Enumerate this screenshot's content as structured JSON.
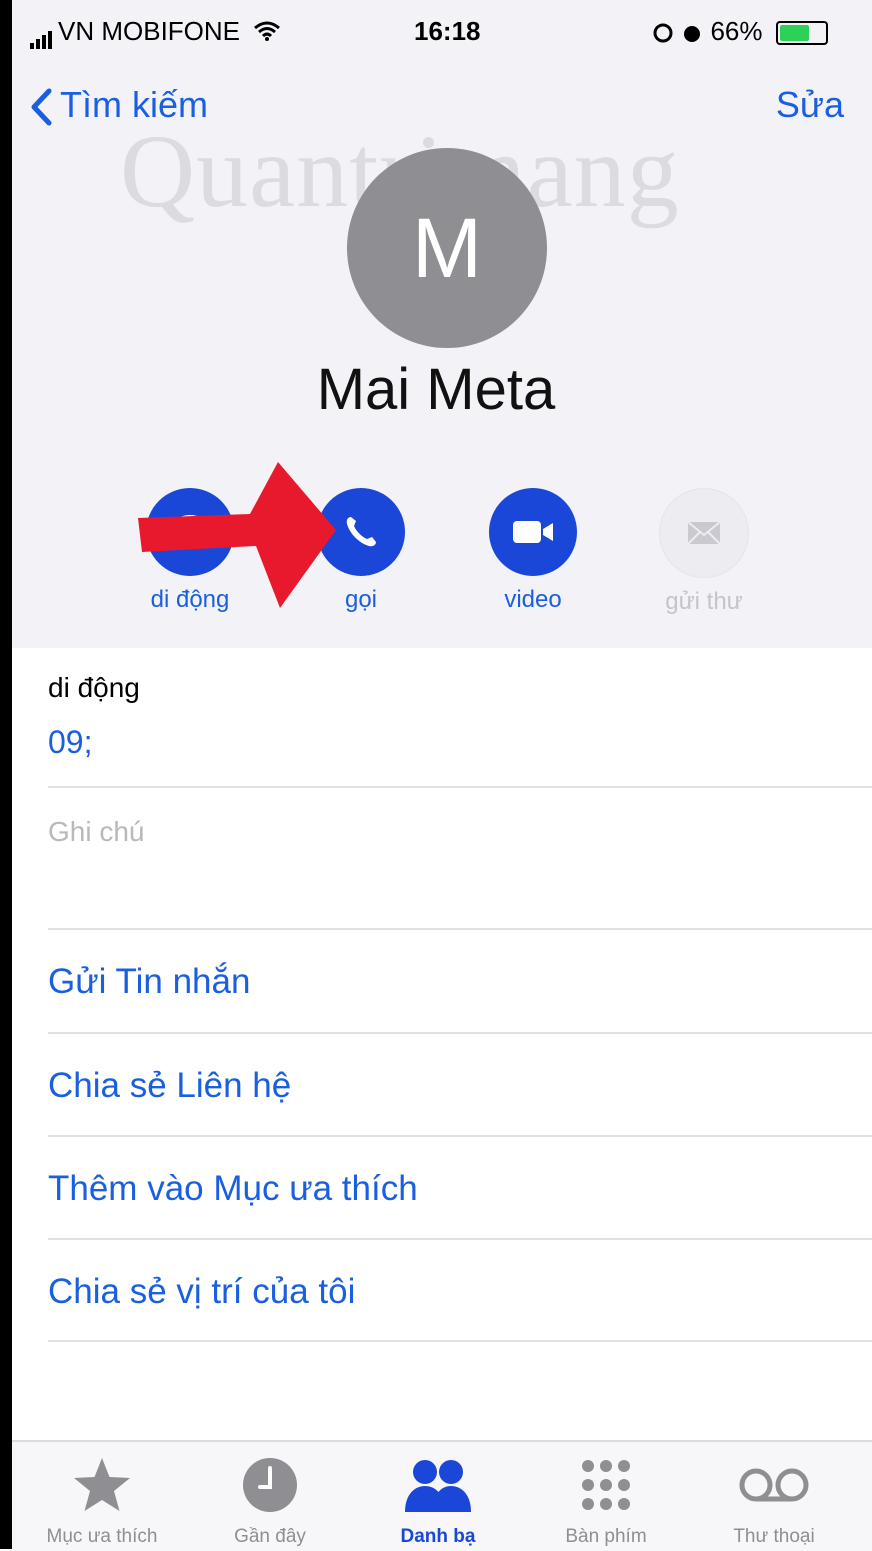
{
  "status_bar": {
    "carrier": "VN MOBIFONE",
    "time": "16:18",
    "battery": "66%",
    "battery_level": 0.66
  },
  "nav": {
    "back_label": "Tìm kiếm",
    "edit_label": "Sửa"
  },
  "watermark": "Quantrimang",
  "contact": {
    "initial": "M",
    "name": "Mai Meta"
  },
  "actions": [
    {
      "label": "di động",
      "icon": "message-bubble-icon",
      "enabled": true
    },
    {
      "label": "gọi",
      "icon": "phone-icon",
      "enabled": true
    },
    {
      "label": "video",
      "icon": "video-camera-icon",
      "enabled": true
    },
    {
      "label": "gửi thư",
      "icon": "mail-icon",
      "enabled": false
    }
  ],
  "phone": {
    "label": "di động",
    "value": "09;"
  },
  "note_placeholder": "Ghi chú",
  "options": [
    "Gửi Tin nhắn",
    "Chia sẻ Liên hệ",
    "Thêm vào Mục ưa thích",
    "Chia sẻ vị trí của tôi"
  ],
  "tabs": [
    {
      "label": "Mục ưa thích",
      "icon": "star-icon",
      "active": false
    },
    {
      "label": "Gần đây",
      "icon": "clock-icon",
      "active": false
    },
    {
      "label": "Danh bạ",
      "icon": "contacts-icon",
      "active": true
    },
    {
      "label": "Bàn phím",
      "icon": "keypad-icon",
      "active": false
    },
    {
      "label": "Thư thoại",
      "icon": "voicemail-icon",
      "active": false
    }
  ],
  "colors": {
    "accent": "#1a47d8",
    "link": "#1a5fe0",
    "arrow": "#e8192c",
    "header_bg": "#f2f2f7"
  }
}
